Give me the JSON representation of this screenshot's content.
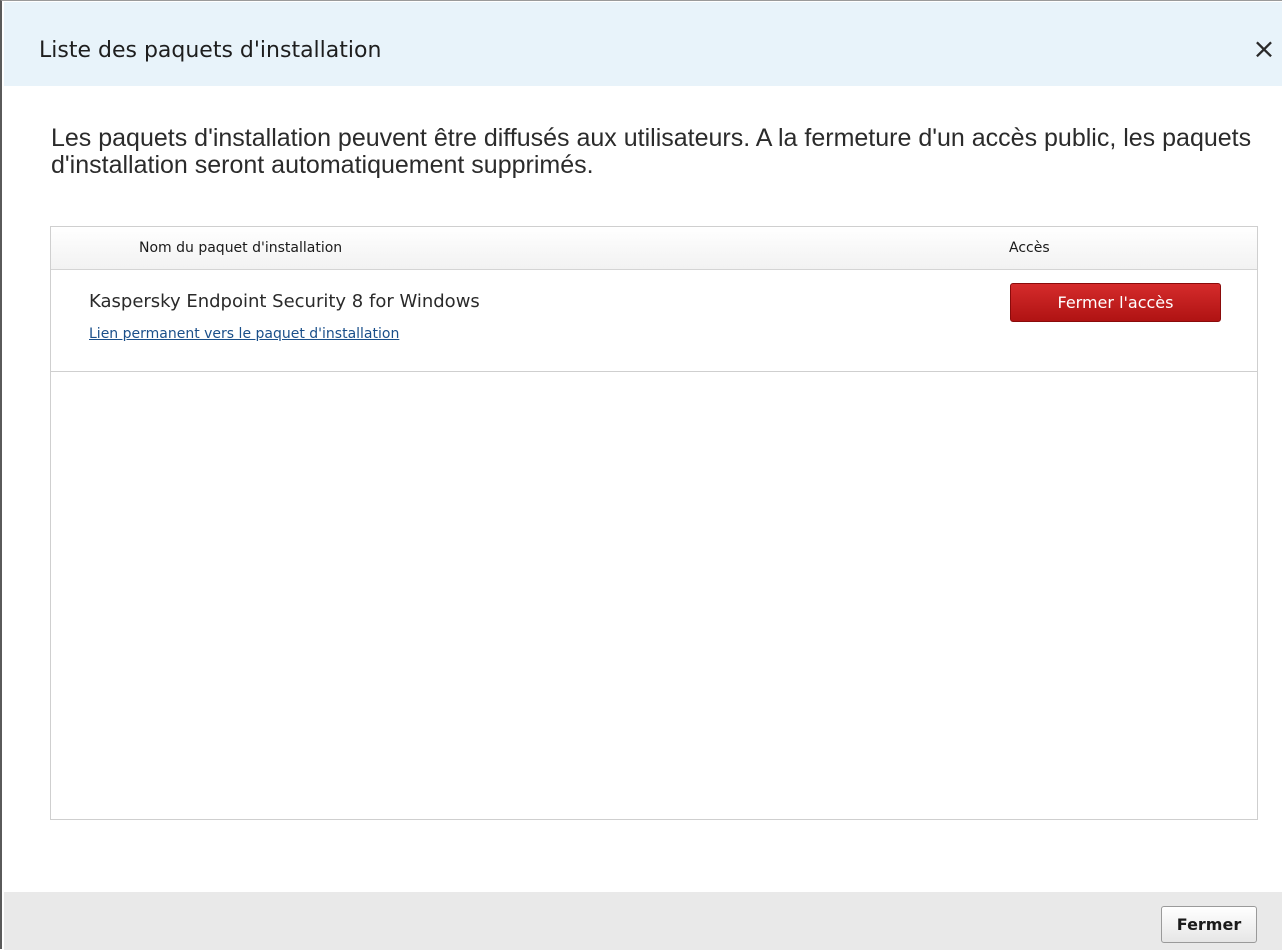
{
  "dialog": {
    "title": "Liste des paquets d'installation",
    "close_icon": "×"
  },
  "description": "Les paquets d'installation peuvent être diffusés aux utilisateurs. A la fermeture d'un accès public, les paquets d'installation seront automatiquement supprimés.",
  "table": {
    "columns": [
      "Nom du paquet d'installation",
      "Accès"
    ],
    "rows": [
      {
        "name": "Kaspersky Endpoint Security 8 for Windows",
        "link": "Lien permanent vers le paquet d'installation",
        "action": "Fermer l'accès"
      }
    ]
  },
  "footer": {
    "close_button": "Fermer"
  },
  "colors": {
    "titlebar": "#e8f3fa",
    "danger_button": "#c41e1e",
    "link": "#1a4f8a",
    "footer": "#e9e9e9"
  }
}
